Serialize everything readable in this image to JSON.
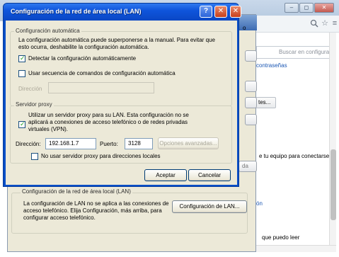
{
  "lan_dialog": {
    "title": "Configuración de la red de área local (LAN)",
    "help_glyph": "?",
    "close_glyph": "✕",
    "auto_config": {
      "legend": "Configuración automática",
      "description": "La configuración automática puede superponerse a la manual. Para evitar que esto ocurra, deshabilite la configuración automática.",
      "detect_label": "Detectar la configuración automáticamente",
      "detect_checked": true,
      "script_label": "Usar secuencia de comandos de configuración automática",
      "script_checked": false,
      "address_label": "Dirección",
      "address_value": ""
    },
    "proxy": {
      "legend": "Servidor proxy",
      "use_proxy_label": "Utilizar un servidor proxy para su LAN. Esta configuración no se aplicará a conexiones de acceso telefónico o de redes privadas virtuales (VPN).",
      "use_proxy_checked": true,
      "address_label": "Dirección:",
      "address_value": "192.168.1.7",
      "port_label": "Puerto:",
      "port_value": "3128",
      "advanced_label": "Opciones avanzadas...",
      "bypass_local_label": "No usar servidor proxy para direcciones locales",
      "bypass_local_checked": false
    },
    "ok_label": "Aceptar",
    "cancel_label": "Cancelar"
  },
  "options_dialog": {
    "lan_group_legend": "Configuración de la red de área local (LAN)",
    "lan_group_text": "La configuración de LAN no se aplica a las conexiones de acceso telefónico. Elija Configuración, más arriba, para configurar acceso telefónico.",
    "lan_settings_button": "Configuración de LAN...",
    "edge_fragments": [
      "o",
      "da"
    ]
  },
  "browser": {
    "search_placeholder": "Buscar en configuración",
    "passwords_link": "contraseñas",
    "sites_button": "tes...",
    "connect_text": "e tu equipo para conectarse",
    "link_fragment": "ón",
    "read_text": "que puedo leer",
    "window_buttons": [
      "–",
      "◻",
      "✕"
    ],
    "toolbar_icons": [
      "magnifier-icon",
      "star-icon",
      "menu-icon"
    ]
  }
}
